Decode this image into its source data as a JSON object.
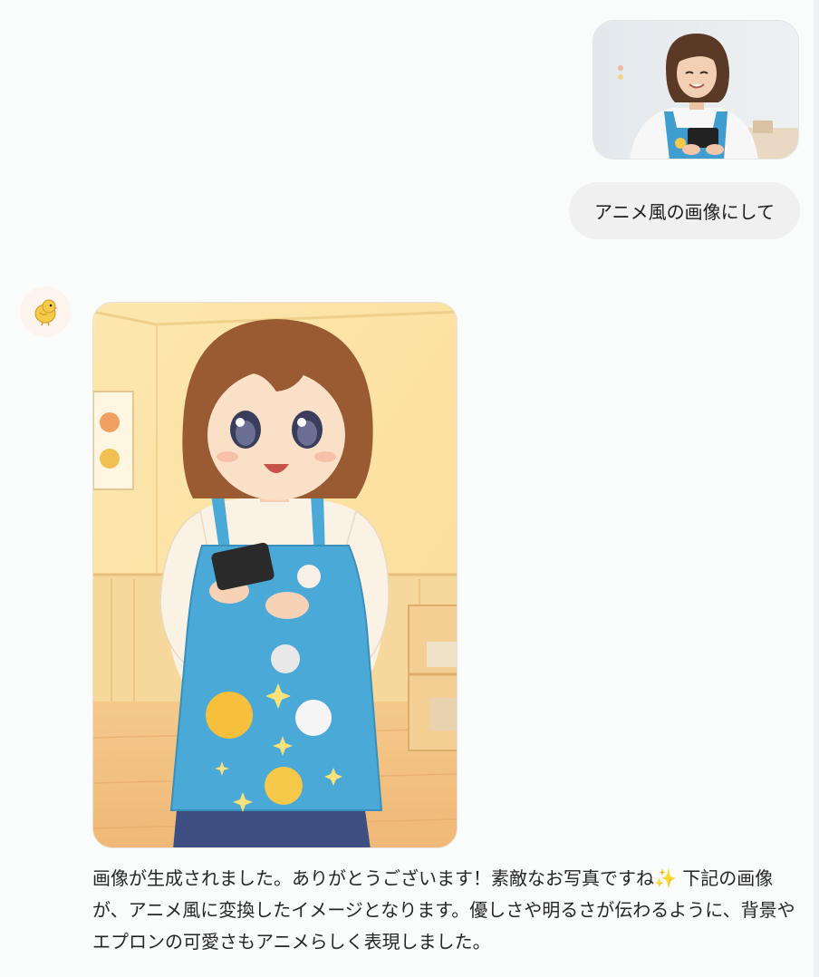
{
  "conversation": {
    "user_message": {
      "image_alt": "",
      "text": "アニメ風の画像にして"
    },
    "assistant_message": {
      "avatar_icon": "chick-icon",
      "image_alt": "",
      "text": "画像が生成されました。ありがとうございます！素敵なお写真ですね✨ 下記の画像が、アニメ風に変換したイメージとなります。優しさや明るさが伝わるように、背景やエプロンの可愛さもアニメらしく表現しました。"
    }
  },
  "colors": {
    "page_background": "#fafbfb",
    "user_bubble": "#f0f0f0",
    "avatar_background": "#fdf4ee",
    "apron_blue": "#4aa9d6"
  }
}
